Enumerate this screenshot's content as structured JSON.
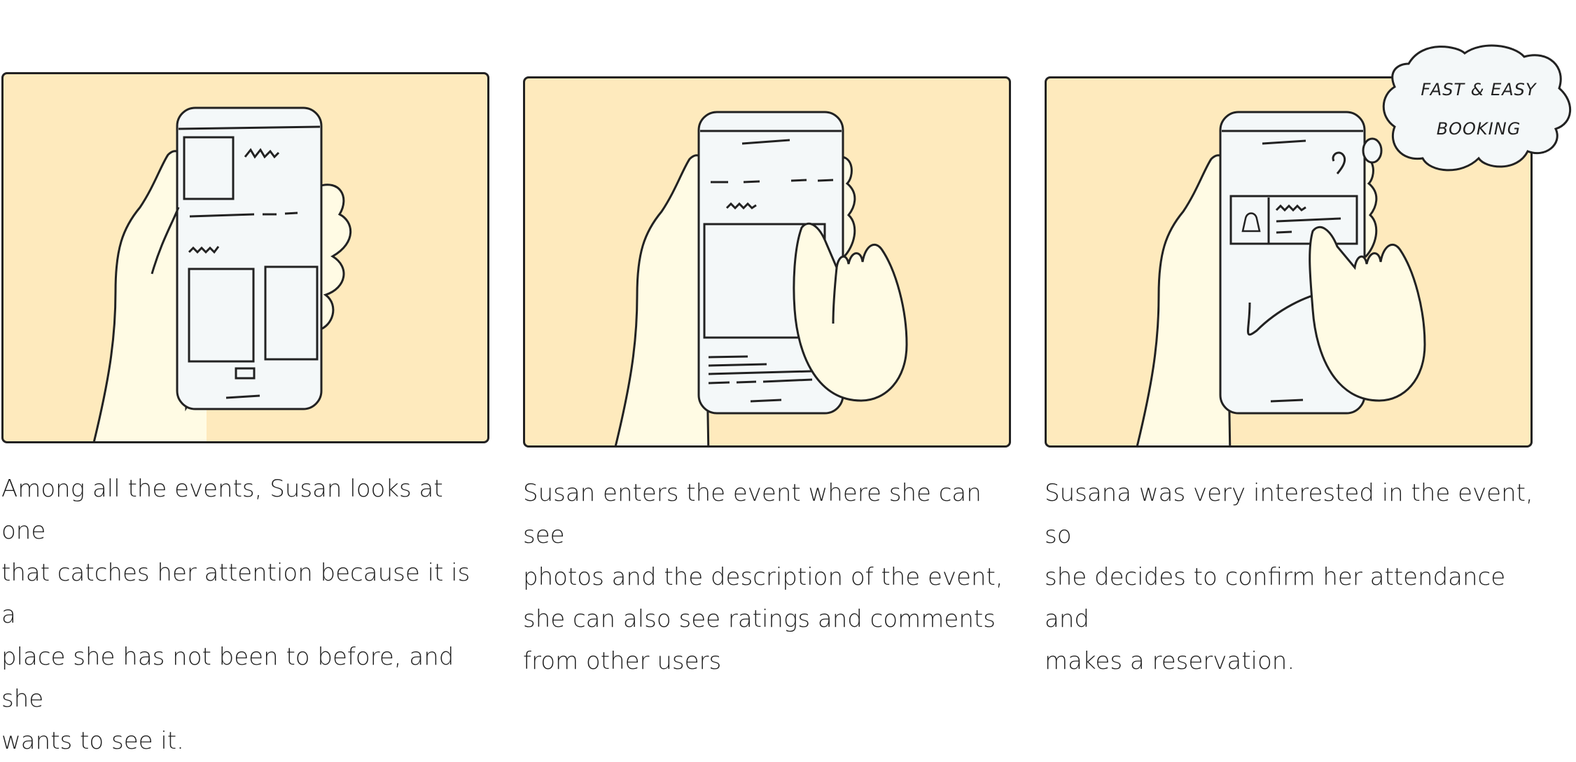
{
  "storyboard": {
    "panels": [
      {
        "id": "browse",
        "caption": "Among all the events, Susan looks at one\nthat catches her attention because it is a\nplace she has not been to before, and she\nwants to see it."
      },
      {
        "id": "details",
        "caption": "Susan enters the event where she can see\nphotos and the description of the event,\nshe can also see ratings and comments\nfrom other users"
      },
      {
        "id": "book",
        "caption": "Susana was very interested in the event, so\nshe decides to confirm her attendance and\nmakes a reservation."
      }
    ],
    "thought_bubble": {
      "line1": "FAST & EASY",
      "line2": "BOOKING"
    }
  },
  "colors": {
    "panel_bg": "#feeabd",
    "skin": "#fffbe4",
    "screen": "#f4f8f9",
    "ink": "#222222"
  }
}
